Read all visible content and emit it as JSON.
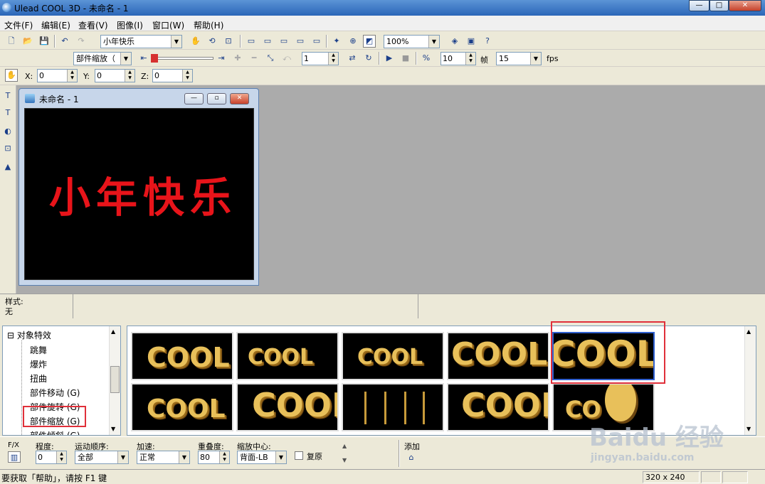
{
  "app": {
    "title": "Ulead COOL 3D - 未命名 - 1"
  },
  "menu": [
    "文件(F)",
    "编辑(E)",
    "查看(V)",
    "图像(I)",
    "窗口(W)",
    "帮助(H)"
  ],
  "toolbar1": {
    "text_select": "小年快乐",
    "zoom": "100%"
  },
  "toolbar2": {
    "effect_select": "部件缩放（",
    "frame": "1",
    "fps_value": "10",
    "frame_label": "帧",
    "frames": "15",
    "fps_label": "fps"
  },
  "toolbar3": {
    "x_label": "X:",
    "x": "0",
    "y_label": "Y:",
    "y": "0",
    "z_label": "Z:",
    "z": "0"
  },
  "document": {
    "title": "未命名 - 1",
    "canvas_text": "小年快乐"
  },
  "style": {
    "label": "样式:",
    "value": "无"
  },
  "effects_tree": {
    "root": "对象特效",
    "items": [
      "跳舞",
      "爆炸",
      "扭曲",
      "部件移动 (G)",
      "部件旋转 (G)",
      "部件缩放 (G)",
      "部件倾斜 (G)"
    ]
  },
  "thumbnails": [
    "COOL",
    "COOL",
    "COOL",
    "COOL",
    "COOL",
    "COOL",
    "COOL",
    "",
    "COOL",
    "CO"
  ],
  "controls": {
    "fx": "F/X",
    "degree_label": "程度:",
    "degree": "0",
    "order_label": "运动顺序:",
    "order": "全部",
    "accel_label": "加速:",
    "accel": "正常",
    "overlap_label": "重叠度:",
    "overlap": "80",
    "center_label": "缩放中心:",
    "center": "背面-LB",
    "reset_label": "复原",
    "add_label": "添加"
  },
  "status": {
    "help": "要获取「帮助」，请按 F1 键",
    "size": "320 x 240"
  },
  "watermark": {
    "brand": "Baidu 经验",
    "url": "jingyan.baidu.com"
  },
  "colors": {
    "canvas_text": "#e8141a",
    "selection_box": "#e0303a"
  }
}
